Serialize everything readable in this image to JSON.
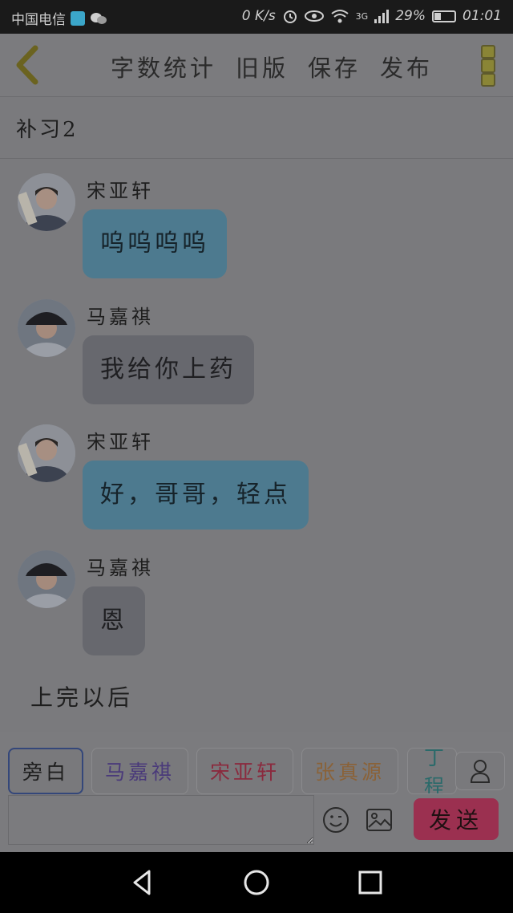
{
  "status_bar": {
    "carrier": "中国电信",
    "speed": "0 K/s",
    "network": "3G",
    "battery": "29%",
    "time": "01:01"
  },
  "toolbar": {
    "actions": [
      "字数统计",
      "旧版",
      "保存",
      "发布"
    ]
  },
  "chapter_title": "补习2",
  "messages": [
    {
      "sender": "宋亚轩",
      "text": "呜呜呜呜",
      "style": "blue"
    },
    {
      "sender": "马嘉祺",
      "text": "我给你上药",
      "style": "gray"
    },
    {
      "sender": "宋亚轩",
      "text": "好，哥哥，轻点",
      "style": "blue"
    },
    {
      "sender": "马嘉祺",
      "text": "恩",
      "style": "gray"
    }
  ],
  "narration": "上完以后",
  "roles": [
    {
      "label": "旁白",
      "color": "#1e1e1e"
    },
    {
      "label": "马嘉祺",
      "color": "#4a3a7a"
    },
    {
      "label": "宋亚轩",
      "color": "#8a2a3e"
    },
    {
      "label": "张真源",
      "color": "#8a6238"
    },
    {
      "label": "丁程",
      "color": "#2a6a6a"
    }
  ],
  "input": {
    "placeholder": "",
    "value": ""
  },
  "send_label": "发送"
}
